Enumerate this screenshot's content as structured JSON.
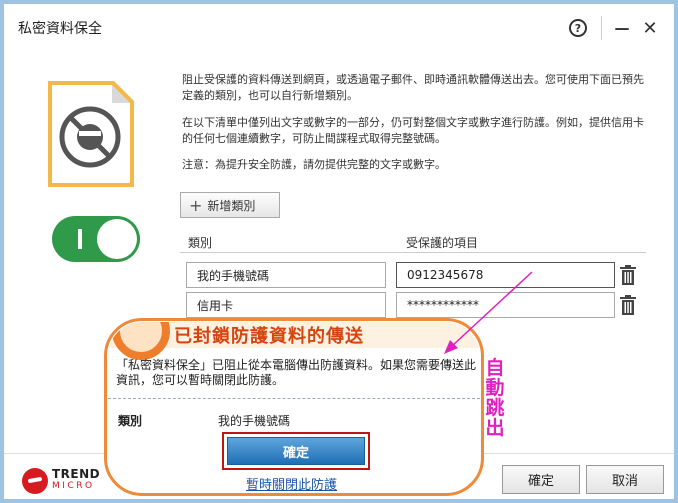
{
  "window": {
    "title": "私密資料保全",
    "help_label": "?",
    "minimize_label": "—",
    "close_label": "✕"
  },
  "description": {
    "p1": "阻止受保護的資料傳送到網頁，或透過電子郵件、即時通訊軟體傳送出去。您可使用下面已預先定義的類別，也可以自行新增類別。",
    "p2": "在以下清單中僅列出文字或數字的一部分，仍可對整個文字或數字進行防護。例如，提供信用卡的任何七個連續數字，可防止間諜程式取得完整號碼。",
    "p3": "注意：為提升安全防護，請勿提供完整的文字或數字。"
  },
  "toggle": {
    "state": "on",
    "on_label": "I",
    "color": "#2e9a4a"
  },
  "add_button": {
    "icon": "plus-icon",
    "label": "新增類別"
  },
  "table": {
    "headers": [
      "類別",
      "受保護的項目"
    ],
    "rows": [
      {
        "category": "我的手機號碼",
        "item": "0912345678"
      },
      {
        "category": "信用卡",
        "item": "************"
      }
    ]
  },
  "footer": {
    "brand": "TREND",
    "brand_sub": "MICRO",
    "ok_label": "確定",
    "cancel_label": "取消"
  },
  "popup": {
    "title": "已封鎖防護資料的傳送",
    "message": "「私密資料保全」已阻止從本電腦傳出防護資料。如果您需要傳送此資訊，您可以暫時關閉此防護。",
    "category_label": "類別",
    "category_value": "我的手機號碼",
    "ok_label": "確定",
    "disable_link": "暫時關閉此防護"
  },
  "annotation": {
    "text": "自動跳出",
    "color": "#e020c0"
  },
  "colors": {
    "accent_orange": "#ef7e2c",
    "popup_title": "#d4450f",
    "button_blue": "#1f6fb4",
    "brand_red": "#d71920"
  }
}
